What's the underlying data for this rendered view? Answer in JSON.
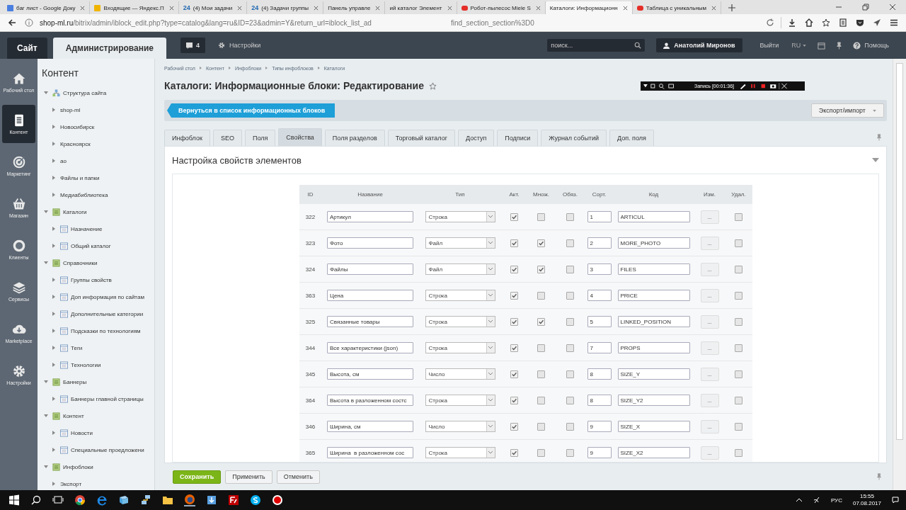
{
  "browser": {
    "tabs": [
      {
        "title": "баг лист - Google Доку",
        "kind": "doc",
        "selected": false
      },
      {
        "title": "Входящие — Яндекс.П",
        "kind": "mail",
        "selected": false
      },
      {
        "title": "(4) Мои задачи",
        "kind": "b24",
        "badge": "24",
        "selected": false
      },
      {
        "title": "(4) Задачи группы",
        "kind": "b24",
        "badge": "24",
        "selected": false
      },
      {
        "title": "Панель управле",
        "kind": "plain",
        "selected": false
      },
      {
        "title": "ий каталог Элемент",
        "kind": "plain",
        "selected": false
      },
      {
        "title": "Робот-пылесос Miele S",
        "kind": "video",
        "selected": false
      },
      {
        "title": "Каталоги: Информационн",
        "kind": "plain",
        "selected": true
      },
      {
        "title": "Таблица с уникальным",
        "kind": "video",
        "selected": false
      }
    ],
    "url_start": "shop-ml.ru",
    "url_rest": "/bitrix/admin/iblock_edit.php?type=catalog&lang=ru&ID=23&admin=Y&return_url=iblock_list_ad",
    "url_tail": "find_section_section%3D0"
  },
  "header": {
    "tabs": [
      {
        "label": "Сайт",
        "selected": false
      },
      {
        "label": "Администрирование",
        "selected": true
      }
    ],
    "notifications": "4",
    "settings": "Настройки",
    "search_placeholder": "поиск...",
    "user": "Анатолий Миронов",
    "logout": "Выйти",
    "language": "RU",
    "help": "Помощь"
  },
  "menu": [
    {
      "label": "Рабочий стол",
      "kind": "home",
      "selected": false
    },
    {
      "label": "Контент",
      "kind": "doc",
      "selected": true
    },
    {
      "label": "Маркетинг",
      "kind": "target",
      "selected": false
    },
    {
      "label": "Магазин",
      "kind": "basket",
      "selected": false
    },
    {
      "label": "Клиенты",
      "kind": "clients",
      "selected": false
    },
    {
      "label": "Сервисы",
      "kind": "layers",
      "selected": false
    },
    {
      "label": "Marketplace",
      "kind": "cloud",
      "selected": false
    },
    {
      "label": "Настройки",
      "kind": "gear",
      "selected": false
    }
  ],
  "tree": {
    "title": "Контент",
    "items": [
      {
        "label": "Структура сайта",
        "kind": "site",
        "expanded": true,
        "children": [
          {
            "label": "shop-ml",
            "kind": "page",
            "expanded": false
          },
          {
            "label": "Новосибирск",
            "kind": "page",
            "expanded": false
          },
          {
            "label": "Красноярск",
            "kind": "page",
            "expanded": false
          },
          {
            "label": "ao",
            "kind": "page",
            "expanded": false
          },
          {
            "label": "Файлы и папки",
            "kind": "page",
            "expanded": false
          },
          {
            "label": "Медиабиблиотека",
            "kind": "page",
            "expanded": false
          }
        ]
      },
      {
        "label": "Каталоги",
        "kind": "type",
        "expanded": true,
        "children": [
          {
            "label": "Назначение",
            "kind": "iblock",
            "expanded": false
          },
          {
            "label": "Общий каталог",
            "kind": "iblock",
            "expanded": false
          }
        ]
      },
      {
        "label": "Справочники",
        "kind": "type",
        "expanded": true,
        "children": [
          {
            "label": "Группы свойств",
            "kind": "iblock",
            "expanded": false
          },
          {
            "label": "Доп информация по сайтам",
            "kind": "iblock",
            "expanded": false
          },
          {
            "label": "Дополнительные категории",
            "kind": "iblock",
            "expanded": false
          },
          {
            "label": "Подсказки по технологиям",
            "kind": "iblock",
            "expanded": false
          },
          {
            "label": "Теги",
            "kind": "iblock",
            "expanded": false
          },
          {
            "label": "Технологии",
            "kind": "iblock",
            "expanded": false
          }
        ]
      },
      {
        "label": "Баннеры",
        "kind": "type",
        "expanded": true,
        "children": [
          {
            "label": "Баннеры главной страницы",
            "kind": "iblock",
            "expanded": false
          }
        ]
      },
      {
        "label": "Контент",
        "kind": "type",
        "expanded": true,
        "children": [
          {
            "label": "Новости",
            "kind": "iblock",
            "expanded": false
          },
          {
            "label": "Специальные проедложени",
            "kind": "iblock",
            "expanded": false
          }
        ]
      },
      {
        "label": "Инфоблоки",
        "kind": "type",
        "expanded": true,
        "children": [
          {
            "label": "Экспорт",
            "kind": "page",
            "expanded": false
          }
        ]
      }
    ]
  },
  "breadcrumbs": [
    "Рабочий стол",
    "Контент",
    "Инфоблоки",
    "Типы инфоблоков",
    "Каталоги"
  ],
  "title": "Каталоги: Информационные блоки: Редактирование",
  "back_button": "Вернуться в список информационных блоков",
  "export_button": "Экспорт/импорт",
  "recorder": {
    "label": "Запись [00:01:36]"
  },
  "tabs": [
    {
      "label": "Инфоблок",
      "selected": false
    },
    {
      "label": "SEO",
      "selected": false
    },
    {
      "label": "Поля",
      "selected": false
    },
    {
      "label": "Свойства",
      "selected": true
    },
    {
      "label": "Поля разделов",
      "selected": false
    },
    {
      "label": "Торговый каталог",
      "selected": false
    },
    {
      "label": "Доступ",
      "selected": false
    },
    {
      "label": "Подписи",
      "selected": false
    },
    {
      "label": "Журнал событий",
      "selected": false
    },
    {
      "label": "Доп. поля",
      "selected": false
    }
  ],
  "section": {
    "title": "Настройка свойств элементов",
    "expanded": true
  },
  "table": {
    "columns": [
      "ID",
      "Название",
      "Тип",
      "Акт.",
      "Множ.",
      "Обяз.",
      "Сорт.",
      "Код",
      "Изм.",
      "Удал."
    ],
    "rows": [
      {
        "id": "322",
        "name": "Артикул",
        "type": "Строка",
        "active": true,
        "multiple": false,
        "required": false,
        "sort": "1",
        "code": "ARTICUL",
        "edit": "...",
        "delete": false
      },
      {
        "id": "323",
        "name": "Фото",
        "type": "Файл",
        "active": true,
        "multiple": true,
        "required": false,
        "sort": "2",
        "code": "MORE_PHOTO",
        "edit": "...",
        "delete": false
      },
      {
        "id": "324",
        "name": "Файлы",
        "type": "Файл",
        "active": true,
        "multiple": true,
        "required": false,
        "sort": "3",
        "code": "FILES",
        "edit": "...",
        "delete": false
      },
      {
        "id": "363",
        "name": "Цена",
        "type": "Строка",
        "active": true,
        "multiple": false,
        "required": false,
        "sort": "4",
        "code": "PRICE",
        "edit": "...",
        "delete": false
      },
      {
        "id": "325",
        "name": "Связанные товары",
        "type": "Строка",
        "active": true,
        "multiple": true,
        "required": false,
        "sort": "5",
        "code": "LINKED_POSITION",
        "edit": "...",
        "delete": false
      },
      {
        "id": "344",
        "name": "Все характеристики (json)",
        "type": "Строка",
        "active": true,
        "multiple": false,
        "required": false,
        "sort": "7",
        "code": "PROPS",
        "edit": "...",
        "delete": false
      },
      {
        "id": "345",
        "name": "Высота, см",
        "type": "Число",
        "active": true,
        "multiple": false,
        "required": false,
        "sort": "8",
        "code": "SIZE_Y",
        "edit": "...",
        "delete": false
      },
      {
        "id": "364",
        "name": "Высота в разложенном состс",
        "type": "Строка",
        "active": true,
        "multiple": false,
        "required": false,
        "sort": "8",
        "code": "SIZE_Y2",
        "edit": "...",
        "delete": false
      },
      {
        "id": "346",
        "name": "Ширина, см",
        "type": "Число",
        "active": true,
        "multiple": false,
        "required": false,
        "sort": "9",
        "code": "SIZE_X",
        "edit": "...",
        "delete": false
      },
      {
        "id": "365",
        "name": "Ширина  в разложенном сос",
        "type": "Строка",
        "active": true,
        "multiple": false,
        "required": false,
        "sort": "9",
        "code": "SIZE_X2",
        "edit": "...",
        "delete": false
      }
    ]
  },
  "footer_buttons": [
    {
      "label": "Сохранить",
      "kind": "primary"
    },
    {
      "label": "Применить",
      "kind": "default"
    },
    {
      "label": "Отменить",
      "kind": "default"
    }
  ],
  "taskbar": {
    "language": "РУС",
    "time": "15:55",
    "date": "07.08.2017"
  }
}
